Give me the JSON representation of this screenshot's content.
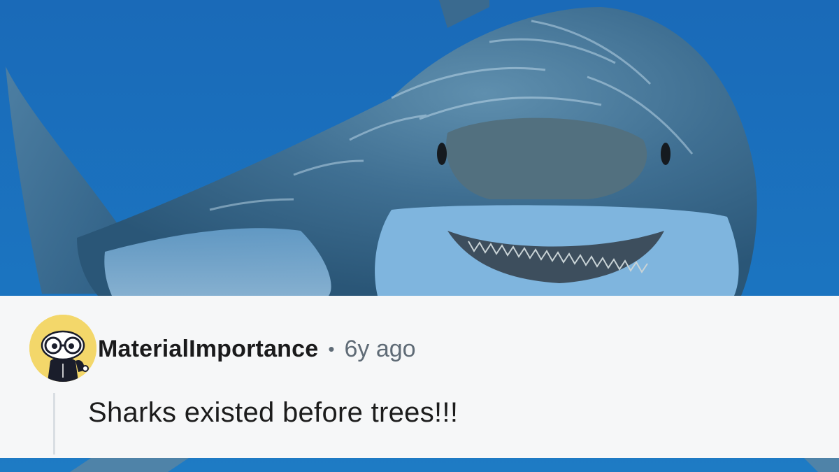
{
  "comment": {
    "username": "MaterialImportance",
    "separator": "•",
    "age": "6y ago",
    "body": "Sharks existed before trees!!!"
  },
  "colors": {
    "ocean": "#1d6fb8",
    "card_background": "#f6f7f8",
    "username_text": "#1a1a1b",
    "meta_text": "#5f6b76",
    "avatar_background": "#f3d76a",
    "thread_line": "#d9dee3"
  },
  "icons": {
    "avatar": "snoo-avatar-with-goggles"
  }
}
